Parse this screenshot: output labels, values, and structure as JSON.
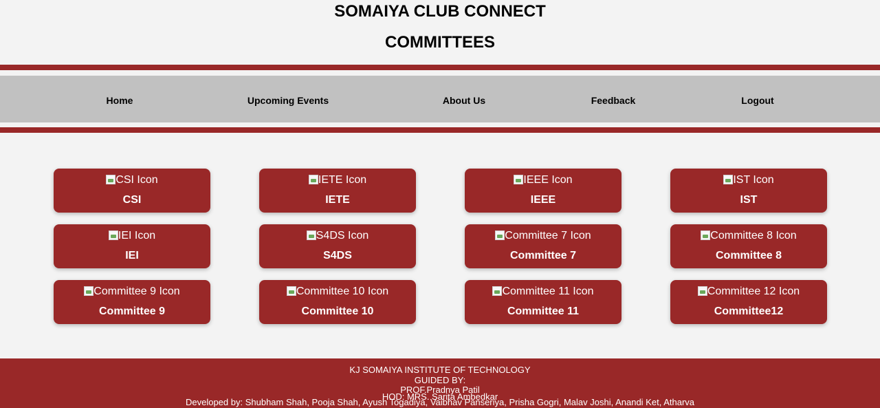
{
  "header": {
    "title": "SOMAIYA CLUB CONNECT",
    "subtitle": "COMMITTEES"
  },
  "nav": {
    "items": [
      {
        "label": "Home"
      },
      {
        "label": "Upcoming Events"
      },
      {
        "label": "About Us"
      },
      {
        "label": "Feedback"
      },
      {
        "label": "Logout"
      }
    ]
  },
  "committees": [
    {
      "icon_alt": "CSI Icon",
      "label": "CSI"
    },
    {
      "icon_alt": "IETE Icon",
      "label": "IETE"
    },
    {
      "icon_alt": "IEEE Icon",
      "label": "IEEE"
    },
    {
      "icon_alt": "IST Icon",
      "label": "IST"
    },
    {
      "icon_alt": "IEI Icon",
      "label": "IEI"
    },
    {
      "icon_alt": "S4DS Icon",
      "label": "S4DS"
    },
    {
      "icon_alt": "Committee 7 Icon",
      "label": "Committee 7"
    },
    {
      "icon_alt": "Committee 8 Icon",
      "label": "Committee 8"
    },
    {
      "icon_alt": "Committee 9 Icon",
      "label": "Committee 9"
    },
    {
      "icon_alt": "Committee 10 Icon",
      "label": "Committee 10"
    },
    {
      "icon_alt": "Committee 11 Icon",
      "label": "Committee 11"
    },
    {
      "icon_alt": "Committee 12 Icon",
      "label": "Committee12"
    }
  ],
  "footer": {
    "institute": "KJ SOMAIYA INSTITUTE OF TECHNOLOGY",
    "guided_by": "GUIDED BY:",
    "guide": "PROF.Pradnya Patil",
    "hod": "HOD: MRS. Sarita Ambedkar",
    "developers": "Developed by: Shubham Shah, Pooja Shah, Ayush Togadiya, Vaibhav Panseriya, Prisha Gogri, Malav Joshi, Anandi Ket, Atharva"
  },
  "colors": {
    "brand": "#992828",
    "nav_bg": "#c1c1c1",
    "page_bg": "#f3f3f3"
  }
}
